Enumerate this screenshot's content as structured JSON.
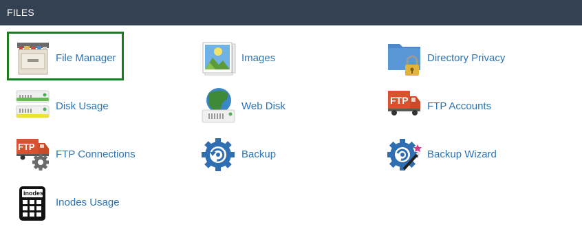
{
  "section": {
    "title": "FILES"
  },
  "items": [
    {
      "label": "File Manager",
      "icon": "file-manager-icon"
    },
    {
      "label": "Images",
      "icon": "images-icon"
    },
    {
      "label": "Directory Privacy",
      "icon": "directory-privacy-icon"
    },
    {
      "label": "Disk Usage",
      "icon": "disk-usage-icon"
    },
    {
      "label": "Web Disk",
      "icon": "web-disk-icon"
    },
    {
      "label": "FTP Accounts",
      "icon": "ftp-accounts-icon"
    },
    {
      "label": "FTP Connections",
      "icon": "ftp-connections-icon"
    },
    {
      "label": "Backup",
      "icon": "backup-icon"
    },
    {
      "label": "Backup Wizard",
      "icon": "backup-wizard-icon"
    },
    {
      "label": "Inodes Usage",
      "icon": "inodes-usage-icon"
    }
  ],
  "icon_text": {
    "ftp": "FTP",
    "inodes": "inodes"
  },
  "colors": {
    "header_bg": "#344152",
    "link": "#2b73b5",
    "highlight": "#1e7a1e"
  }
}
